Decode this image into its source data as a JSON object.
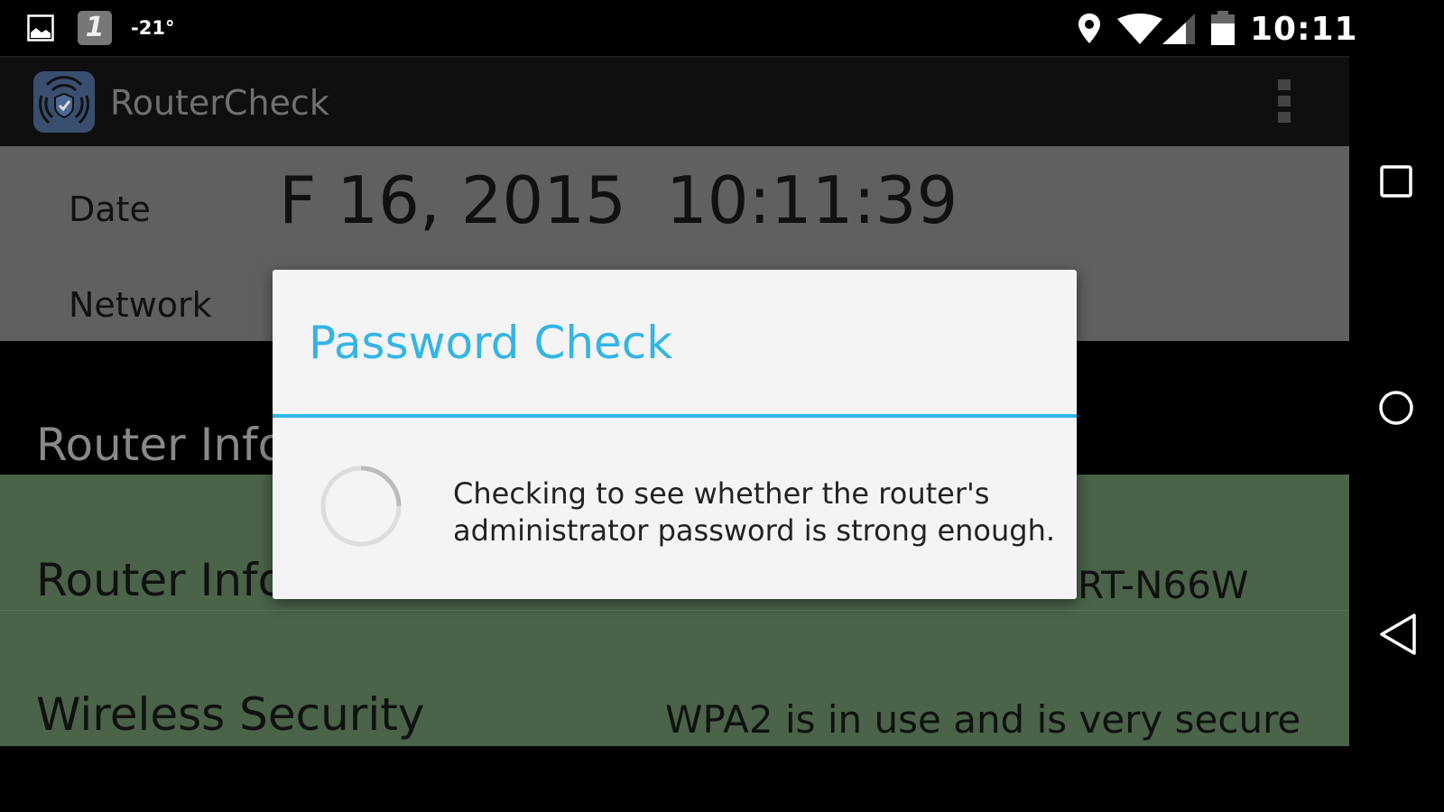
{
  "status_bar": {
    "temperature": "-21°",
    "notification_badge": "1",
    "time": "10:11",
    "icons": [
      "image-icon",
      "app-notification-icon",
      "location-icon",
      "wifi-icon",
      "cell-signal-icon",
      "battery-icon"
    ]
  },
  "app_bar": {
    "title": "RouterCheck",
    "menu_icon": "overflow-menu-icon"
  },
  "info": {
    "date_label": "Date",
    "date_value": "F 16, 2015",
    "time_value": "10:11:39",
    "network_label": "Network"
  },
  "section": {
    "title": "Router Info"
  },
  "rows": [
    {
      "label": "Router Info",
      "value": "RT-N66W"
    },
    {
      "label": "Wireless Security",
      "value": "WPA2 is in use and is very secure"
    }
  ],
  "dialog": {
    "title": "Password Check",
    "message_line1": "Checking to see whether the router's",
    "message_line2": "administrator password is strong enough.",
    "accent": "#33b5e5"
  },
  "nav_bar": [
    "recents-icon",
    "home-icon",
    "back-icon"
  ]
}
